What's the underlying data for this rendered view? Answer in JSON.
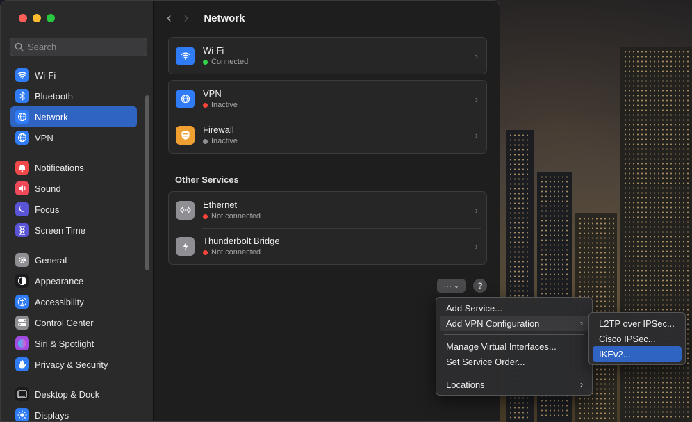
{
  "window": {
    "title": "Network"
  },
  "search": {
    "placeholder": "Search"
  },
  "sidebar": {
    "groups": [
      [
        {
          "label": "Wi-Fi",
          "icon": "wifi-icon",
          "color": "#2f7cf6"
        },
        {
          "label": "Bluetooth",
          "icon": "bluetooth-icon",
          "color": "#2f7cf6"
        },
        {
          "label": "Network",
          "icon": "globe-icon",
          "color": "#2f7cf6",
          "active": true
        },
        {
          "label": "VPN",
          "icon": "globe-icon",
          "color": "#2f7cf6"
        }
      ],
      [
        {
          "label": "Notifications",
          "icon": "bell-icon",
          "color": "#ef4a4a"
        },
        {
          "label": "Sound",
          "icon": "speaker-icon",
          "color": "#ef4a5a"
        },
        {
          "label": "Focus",
          "icon": "moon-icon",
          "color": "#5a55d6"
        },
        {
          "label": "Screen Time",
          "icon": "hourglass-icon",
          "color": "#5a55d6"
        }
      ],
      [
        {
          "label": "General",
          "icon": "gear-icon",
          "color": "#8e8e93"
        },
        {
          "label": "Appearance",
          "icon": "appearance-icon",
          "color": "#1c1c1e"
        },
        {
          "label": "Accessibility",
          "icon": "accessibility-icon",
          "color": "#2f7cf6"
        },
        {
          "label": "Control Center",
          "icon": "toggles-icon",
          "color": "#8e8e93"
        },
        {
          "label": "Siri & Spotlight",
          "icon": "siri-icon",
          "color": "#a14be0"
        },
        {
          "label": "Privacy & Security",
          "icon": "hand-icon",
          "color": "#2f7cf6"
        }
      ],
      [
        {
          "label": "Desktop & Dock",
          "icon": "dock-icon",
          "color": "#1c1c1e"
        },
        {
          "label": "Displays",
          "icon": "sun-icon",
          "color": "#2f7cf6"
        }
      ]
    ]
  },
  "services": [
    {
      "title": "Wi-Fi",
      "status": "Connected",
      "status_color": "#32d74b",
      "icon": "wifi-icon",
      "icon_color": "#2f7cf6"
    }
  ],
  "services2": [
    {
      "title": "VPN",
      "status": "Inactive",
      "status_color": "#ff453a",
      "icon": "globe-icon",
      "icon_color": "#2f7cf6"
    },
    {
      "title": "Firewall",
      "status": "Inactive",
      "status_color": "#8e8e93",
      "icon": "firewall-icon",
      "icon_color": "#f0a030"
    }
  ],
  "other_services": {
    "title": "Other Services",
    "items": [
      {
        "title": "Ethernet",
        "status": "Not connected",
        "status_color": "#ff453a",
        "icon": "ethernet-icon",
        "icon_color": "#8e8e93"
      },
      {
        "title": "Thunderbolt Bridge",
        "status": "Not connected",
        "status_color": "#ff453a",
        "icon": "thunderbolt-icon",
        "icon_color": "#8e8e93"
      }
    ]
  },
  "actions": {
    "more": "···",
    "help": "?"
  },
  "menu": {
    "items": [
      {
        "label": "Add Service..."
      },
      {
        "label": "Add VPN Configuration",
        "submenu": true,
        "highlight": true
      },
      {
        "sep": true
      },
      {
        "label": "Manage Virtual Interfaces..."
      },
      {
        "label": "Set Service Order..."
      },
      {
        "sep": true
      },
      {
        "label": "Locations",
        "submenu": true
      }
    ]
  },
  "submenu": {
    "items": [
      {
        "label": "L2TP over IPSec..."
      },
      {
        "label": "Cisco IPSec..."
      },
      {
        "label": "IKEv2...",
        "selected": true
      }
    ]
  }
}
